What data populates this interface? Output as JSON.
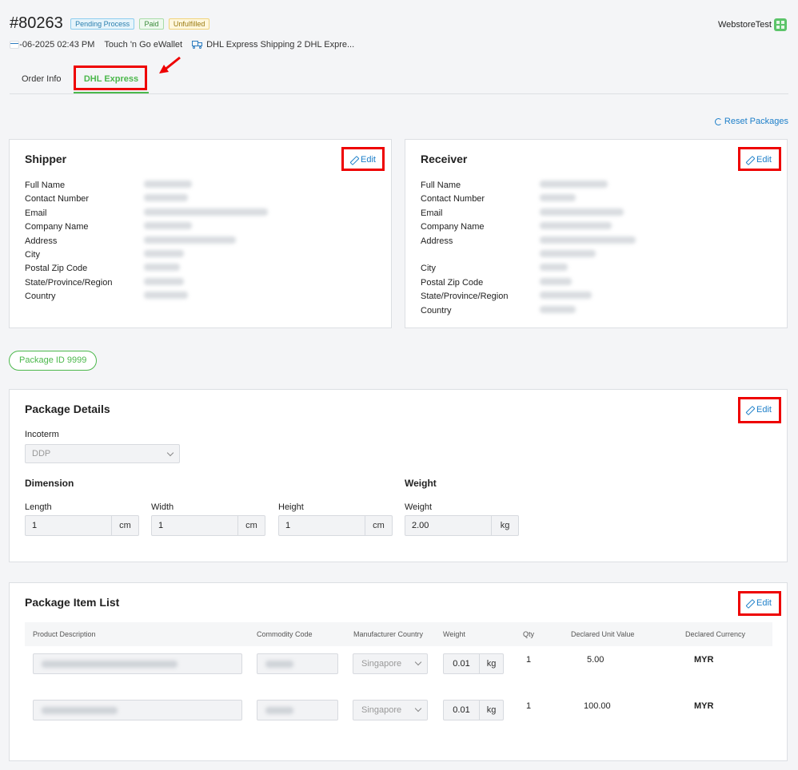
{
  "order": {
    "number": "#80263",
    "badges": {
      "pending": "Pending Process",
      "paid": "Paid",
      "unfulfilled": "Unfulfilled"
    },
    "datetime": "12-06-2025 02:43 PM",
    "payment": "Touch 'n Go eWallet",
    "shipping": "DHL Express Shipping 2 DHL Expre..."
  },
  "store": {
    "name": "WebstoreTest"
  },
  "tabs": {
    "order_info": "Order Info",
    "dhl_express": "DHL Express"
  },
  "reset_label": "Reset Packages",
  "edit_label": "Edit",
  "shipper": {
    "title": "Shipper",
    "fields": [
      "Full Name",
      "Contact Number",
      "Email",
      "Company Name",
      "Address",
      "City",
      "Postal Zip Code",
      "State/Province/Region",
      "Country"
    ]
  },
  "receiver": {
    "title": "Receiver",
    "fields": [
      "Full Name",
      "Contact Number",
      "Email",
      "Company Name",
      "Address",
      "",
      "City",
      "Postal Zip Code",
      "State/Province/Region",
      "Country"
    ]
  },
  "package_pill": "Package ID 9999",
  "package_details": {
    "title": "Package Details",
    "incoterm_label": "Incoterm",
    "incoterm_value": "DDP",
    "dimension_label": "Dimension",
    "weight_section_label": "Weight",
    "length_label": "Length",
    "width_label": "Width",
    "height_label": "Height",
    "weight_label": "Weight",
    "length_value": "1",
    "width_value": "1",
    "height_value": "1",
    "weight_value": "2.00",
    "dim_unit": "cm",
    "weight_unit": "kg"
  },
  "item_list": {
    "title": "Package Item List",
    "headers": [
      "Product Description",
      "Commodity Code",
      "Manufacturer Country",
      "Weight",
      "Qty",
      "Declared Unit Value",
      "Declared Currency"
    ],
    "rows": [
      {
        "country": "Singapore",
        "weight": "0.01",
        "unit": "kg",
        "qty": "1",
        "value": "5.00",
        "currency": "MYR"
      },
      {
        "country": "Singapore",
        "weight": "0.01",
        "unit": "kg",
        "qty": "1",
        "value": "100.00",
        "currency": "MYR"
      }
    ]
  },
  "colors": {
    "accent_green": "#4cb84c",
    "link_blue": "#1d7fc9",
    "highlight_red": "#e00000"
  },
  "icons": [
    "card-icon",
    "truck-icon",
    "store-grid-icon",
    "reset-icon",
    "pencil-icon",
    "chevron-down-icon",
    "annotation-arrow"
  ]
}
